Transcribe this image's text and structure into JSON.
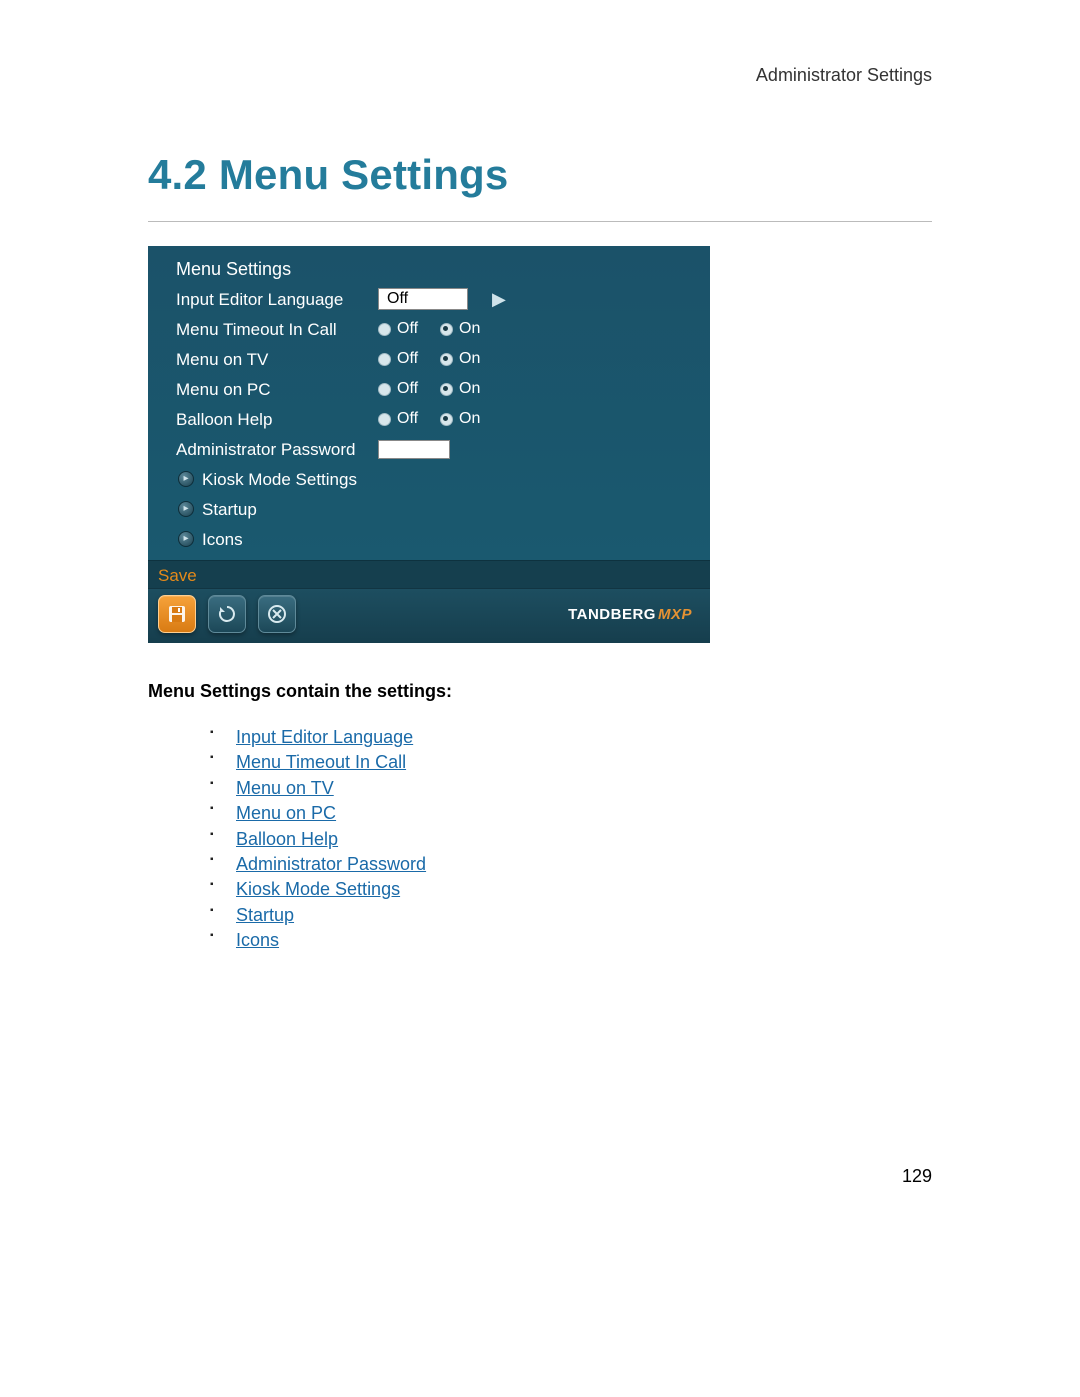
{
  "header": {
    "right": "Administrator Settings"
  },
  "title": "4.2 Menu Settings",
  "screenshot": {
    "panel_title": "Menu Settings",
    "dropdown": {
      "label": "Input Editor Language",
      "value": "Off"
    },
    "radio_rows": [
      {
        "label": "Menu Timeout In Call",
        "off": "Off",
        "on": "On",
        "selected": "on"
      },
      {
        "label": "Menu on TV",
        "off": "Off",
        "on": "On",
        "selected": "on"
      },
      {
        "label": "Menu on PC",
        "off": "Off",
        "on": "On",
        "selected": "on"
      },
      {
        "label": "Balloon Help",
        "off": "Off",
        "on": "On",
        "selected": "on"
      }
    ],
    "password_label": "Administrator Password",
    "sub_items": [
      "Kiosk Mode Settings",
      "Startup",
      "Icons"
    ],
    "save_label": "Save",
    "logo_main": "TANDBERG",
    "logo_suffix": "MXP"
  },
  "subtitle": "Menu Settings contain the settings:",
  "links": [
    "Input Editor Language",
    "Menu Timeout In Call",
    "Menu on TV",
    "Menu on PC",
    "Balloon Help",
    "Administrator Password",
    "Kiosk Mode Settings",
    "Startup",
    "Icons"
  ],
  "page_number": "129"
}
